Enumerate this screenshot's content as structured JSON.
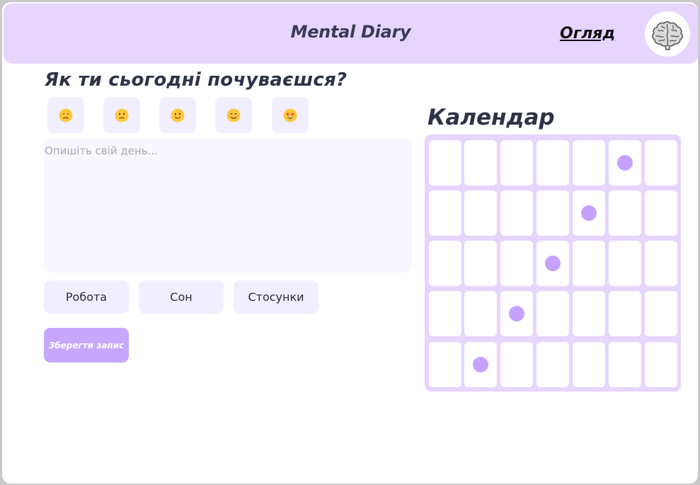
{
  "header": {
    "title": "Mental Diary",
    "nav_link": "Огляд",
    "avatar_icon": "brain-icon"
  },
  "mood": {
    "question": "Як ти сьогодні почуваєшся?",
    "options": [
      {
        "name": "disappointed-face-icon",
        "emoji": "😞"
      },
      {
        "name": "neutral-face-icon",
        "emoji": "😐"
      },
      {
        "name": "slightly-smiling-face-icon",
        "emoji": "🙂"
      },
      {
        "name": "smiling-face-icon",
        "emoji": "😊"
      },
      {
        "name": "star-struck-face-icon",
        "emoji": "🤩"
      }
    ]
  },
  "description": {
    "placeholder": "Опишіть свій день...",
    "value": ""
  },
  "tags": [
    "Робота",
    "Сон",
    "Стосунки"
  ],
  "save_label": "Зберегти запис",
  "calendar": {
    "title": "Календар",
    "rows": 5,
    "cols": 7,
    "marked": [
      [
        0,
        5
      ],
      [
        1,
        4
      ],
      [
        2,
        3
      ],
      [
        3,
        2
      ],
      [
        4,
        1
      ]
    ]
  },
  "colors": {
    "accent": "#e6d5ff",
    "button": "#c6a8ff",
    "dot": "#c6a2ff"
  }
}
